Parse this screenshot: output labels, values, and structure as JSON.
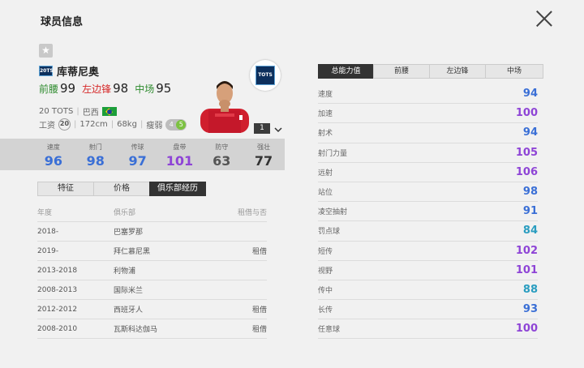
{
  "header": {
    "title": "球员信息"
  },
  "player": {
    "season_badge": "20TS",
    "name": "库蒂尼奥",
    "positions": [
      {
        "label": "前腰",
        "value": "99",
        "color": "#2e8b2e"
      },
      {
        "label": "左边锋",
        "value": "98",
        "color": "#d62b2b"
      },
      {
        "label": "中场",
        "value": "95",
        "color": "#2e8b2e"
      }
    ],
    "season": "20 TOTS",
    "nationality": "巴西",
    "salary_label": "工资",
    "salary": "20",
    "height": "172cm",
    "weight": "68kg",
    "body_type": "瘦弱",
    "weak_foot_left": "4",
    "weak_foot_right": "5",
    "level": "1",
    "season_logo_text": "TOTS"
  },
  "stat_bar": [
    {
      "label": "速度",
      "value": "96",
      "color": "#3a6fd6"
    },
    {
      "label": "射门",
      "value": "98",
      "color": "#3a6fd6"
    },
    {
      "label": "传球",
      "value": "97",
      "color": "#3a6fd6"
    },
    {
      "label": "盘带",
      "value": "101",
      "color": "#8e44d6"
    },
    {
      "label": "防守",
      "value": "63",
      "color": "#555555"
    },
    {
      "label": "强壮",
      "value": "77",
      "color": "#333333"
    }
  ],
  "left_tabs": [
    {
      "label": "特征"
    },
    {
      "label": "价格"
    },
    {
      "label": "俱乐部经历"
    }
  ],
  "club_table": {
    "headers": {
      "year": "年度",
      "club": "俱乐部",
      "loan": "租借与否"
    },
    "rows": [
      {
        "year": "2018-",
        "club": "巴塞罗那",
        "loan": ""
      },
      {
        "year": "2019-",
        "club": "拜仁慕尼黑",
        "loan": "租借"
      },
      {
        "year": "2013-2018",
        "club": "利物浦",
        "loan": ""
      },
      {
        "year": "2008-2013",
        "club": "国际米兰",
        "loan": ""
      },
      {
        "year": "2012-2012",
        "club": "西班牙人",
        "loan": "租借"
      },
      {
        "year": "2008-2010",
        "club": "瓦斯科达伽马",
        "loan": "租借"
      }
    ]
  },
  "right_tabs": [
    {
      "label": "总能力值"
    },
    {
      "label": "前腰"
    },
    {
      "label": "左边锋"
    },
    {
      "label": "中场"
    }
  ],
  "attributes": [
    {
      "name": "速度",
      "value": "94",
      "color": "#3a6fd6"
    },
    {
      "name": "加速",
      "value": "100",
      "color": "#8e44d6"
    },
    {
      "name": "射术",
      "value": "94",
      "color": "#3a6fd6"
    },
    {
      "name": "射门力量",
      "value": "105",
      "color": "#8e44d6"
    },
    {
      "name": "远射",
      "value": "106",
      "color": "#8e44d6"
    },
    {
      "name": "站位",
      "value": "98",
      "color": "#3a6fd6"
    },
    {
      "name": "凌空抽射",
      "value": "91",
      "color": "#3a6fd6"
    },
    {
      "name": "罚点球",
      "value": "84",
      "color": "#2a9dc0"
    },
    {
      "name": "短传",
      "value": "102",
      "color": "#8e44d6"
    },
    {
      "name": "视野",
      "value": "101",
      "color": "#8e44d6"
    },
    {
      "name": "传中",
      "value": "88",
      "color": "#2a9dc0"
    },
    {
      "name": "长传",
      "value": "93",
      "color": "#3a6fd6"
    },
    {
      "name": "任意球",
      "value": "100",
      "color": "#8e44d6"
    }
  ]
}
